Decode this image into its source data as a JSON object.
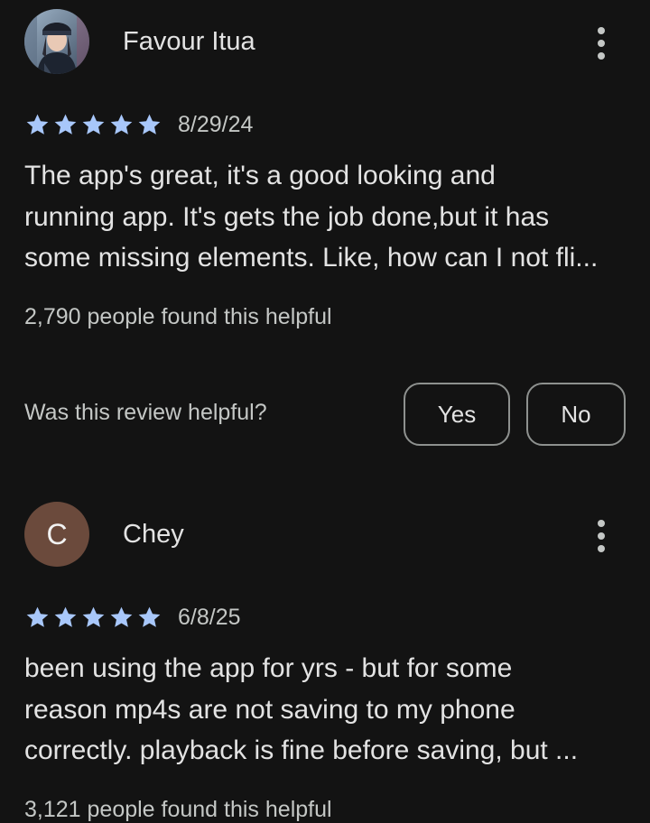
{
  "reviews": [
    {
      "author": "Favour Itua",
      "avatar": "user-photo",
      "rating": 5,
      "date": "8/29/24",
      "text_lines": [
        "The app's great, it's a good looking and",
        "running app. It's gets the job done,but it has",
        "some missing elements. Like, how can I not fli..."
      ],
      "helpful_count": "2,790 people found this helpful",
      "helpful_question": "Was this review helpful?",
      "yes_label": "Yes",
      "no_label": "No"
    },
    {
      "author": "Chey",
      "avatar_letter": "C",
      "rating": 5,
      "date": "6/8/25",
      "text_lines": [
        "been using the app for yrs - but for some",
        "reason mp4s are not saving to my phone",
        "correctly. playback is fine before saving, but ..."
      ],
      "helpful_count": "3,121 people found this helpful"
    }
  ],
  "colors": {
    "background": "#131313",
    "star": "#a8c7fa",
    "avatar_c": "#6b4a3c"
  },
  "icons": {
    "more": "more-vert-icon",
    "star": "star-icon"
  }
}
